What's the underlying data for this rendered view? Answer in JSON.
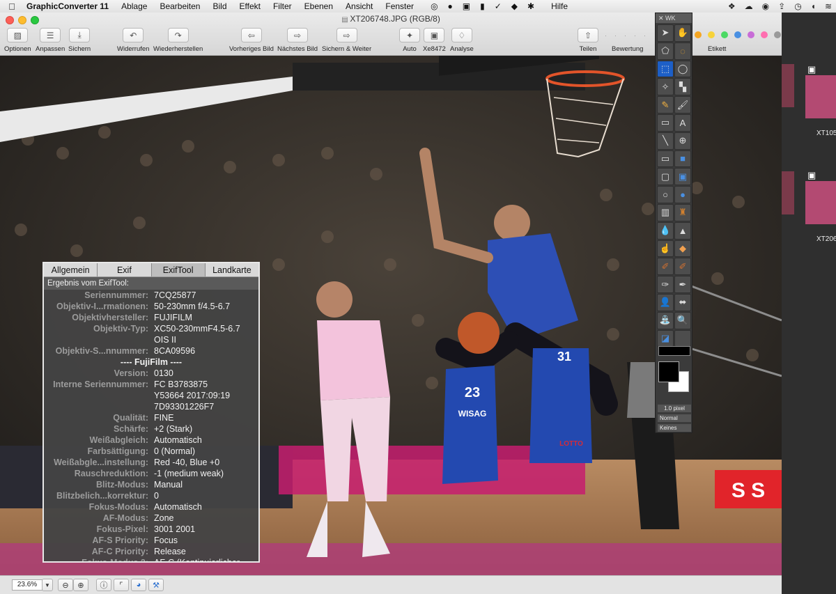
{
  "menubar": {
    "app": "GraphicConverter 11",
    "items": [
      "Ablage",
      "Bearbeiten",
      "Bild",
      "Effekt",
      "Filter",
      "Ebenen",
      "Ansicht",
      "Fenster"
    ],
    "help": "Hilfe"
  },
  "window": {
    "title": "XT206748.JPG (RGB/8)"
  },
  "toolbar": {
    "buttons": [
      {
        "label": "Optionen",
        "icon": "options-icon"
      },
      {
        "label": "Anpassen",
        "icon": "adjust-icon"
      },
      {
        "label": "Sichern",
        "icon": "save-icon"
      },
      {
        "label": "Widerrufen",
        "icon": "undo-icon"
      },
      {
        "label": "Wiederherstellen",
        "icon": "redo-icon"
      },
      {
        "label": "Vorheriges Bild",
        "icon": "previous-icon"
      },
      {
        "label": "Nächstes Bild",
        "icon": "next-icon"
      },
      {
        "label": "Sichern & Weiter",
        "icon": "save-next-icon"
      },
      {
        "label": "Auto",
        "icon": "magic-wand-icon"
      },
      {
        "label": "Xe8472",
        "icon": "picture-icon"
      },
      {
        "label": "Analyse",
        "icon": "lightbulb-icon"
      },
      {
        "label": "Teilen",
        "icon": "share-icon"
      }
    ],
    "rating_label": "Bewertung",
    "label_label": "Etikett",
    "label_colors": [
      "#f5a623",
      "#f7d33a",
      "#4cd964",
      "#4a90e2",
      "#c86dd7",
      "#ff6fb0",
      "#9a9a9a"
    ]
  },
  "palette": {
    "title": "WK",
    "line_width": "1.0 pixel",
    "mode": "Normal",
    "style": "Keines",
    "foreground_color": "#000000",
    "background_color": "#ffffff"
  },
  "exif": {
    "tabs": [
      "Allgemein",
      "Exif",
      "ExifTool",
      "Landkarte"
    ],
    "active_tab": "ExifTool",
    "header": "Ergebnis vom ExifTool:",
    "rows": [
      {
        "k": "Seriennummer:",
        "v": "7CQ25877"
      },
      {
        "k": "Objektiv-I...rmationen:",
        "v": "50-230mm f/4.5-6.7"
      },
      {
        "k": "Objektivhersteller:",
        "v": "FUJIFILM"
      },
      {
        "k": "Objektiv-Typ:",
        "v": "XC50-230mmF4.5-6.7"
      },
      {
        "k": "",
        "v": "OIS II"
      },
      {
        "k": "Objektiv-S...nnummer:",
        "v": "8CA09596"
      },
      {
        "section": "---- FujiFilm ----"
      },
      {
        "k": "Version:",
        "v": "0130"
      },
      {
        "k": "Interne Seriennummer:",
        "v": "FC  B3783875"
      },
      {
        "k": "",
        "v": "Y53664 2017:09:19"
      },
      {
        "k": "",
        "v": "7D93301226F7"
      },
      {
        "k": "Qualität:",
        "v": "FINE"
      },
      {
        "k": "Schärfe:",
        "v": "+2 (Stark)"
      },
      {
        "k": "Weißabgleich:",
        "v": "Automatisch"
      },
      {
        "k": "Farbsättigung:",
        "v": "0 (Normal)"
      },
      {
        "k": "Weißabgle...instellung:",
        "v": "Red -40, Blue +0"
      },
      {
        "k": "Rauschreduktion:",
        "v": "-1 (medium weak)"
      },
      {
        "k": "Blitz-Modus:",
        "v": "Manual"
      },
      {
        "k": "Blitzbelich...korrektur:",
        "v": "0"
      },
      {
        "k": "Fokus-Modus:",
        "v": "Automatisch"
      },
      {
        "k": "AF-Modus:",
        "v": "Zone"
      },
      {
        "k": "Fokus-Pixel:",
        "v": "3001 2001"
      },
      {
        "k": "AF-S Priority:",
        "v": "Focus"
      },
      {
        "k": "AF-C Priority:",
        "v": "Release"
      },
      {
        "k": "Fokus-Modus 2:",
        "v": "AF-C (Kontinuierlicher"
      }
    ]
  },
  "zoom": "23.6%",
  "thumbnails": [
    "XT105",
    "XT206"
  ],
  "photo": {
    "jersey_numbers": [
      "23",
      "31"
    ],
    "jersey_text": "WISAG",
    "ad_text": "LOTTO"
  }
}
